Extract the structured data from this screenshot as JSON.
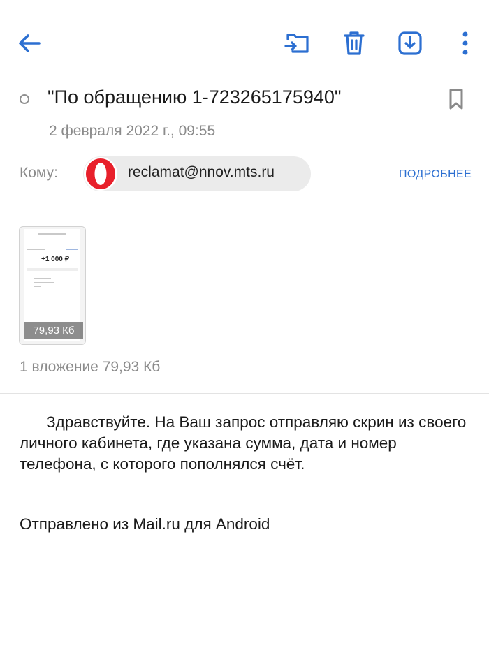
{
  "toolbar": {
    "back_icon": "arrow-left-icon",
    "move_icon": "folder-move-icon",
    "delete_icon": "trash-icon",
    "download_icon": "download-icon",
    "more_icon": "more-vertical-icon",
    "accent_color": "#2c6fd1"
  },
  "message": {
    "subject": "\"По обращению 1-723265175940\"",
    "date": "2 февраля 2022 г., 09:55",
    "to_label": "Кому:",
    "recipient": "reclamat@nnov.mts.ru",
    "recipient_avatar_icon": "opera-logo-icon",
    "details_label": "ПОДРОБНЕЕ"
  },
  "attachments": {
    "items": [
      {
        "thumb_amount": "+1 000 ₽",
        "size": "79,93  Кб"
      }
    ],
    "summary": "1 вложение 79,93  Кб"
  },
  "body": {
    "paragraph": "Здравствуйте. На Ваш запрос отправляю скрин из своего личного кабинета, где указана сумма, дата и номер телефона, с которого пополнялся счёт.",
    "signature": "Отправлено из Mail.ru для Android"
  }
}
